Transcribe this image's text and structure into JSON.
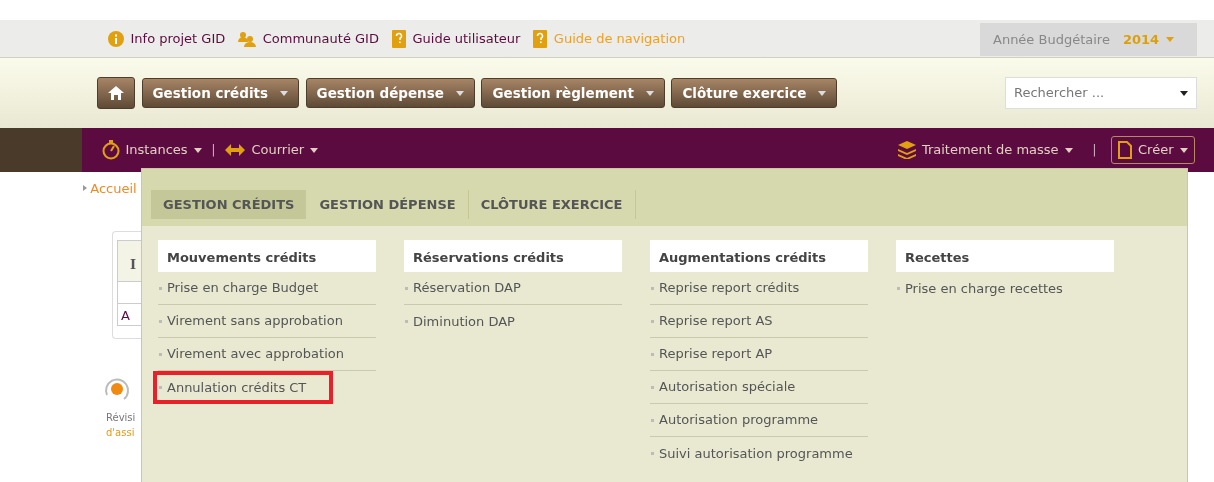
{
  "top_links": [
    {
      "label": "Info projet GID",
      "kind": "info",
      "selected": false
    },
    {
      "label": "Communauté GID",
      "kind": "community",
      "selected": false
    },
    {
      "label": "Guide utilisateur",
      "kind": "guide",
      "selected": false
    },
    {
      "label": "Guide de navigation",
      "kind": "guide",
      "selected": true
    }
  ],
  "year_selector": {
    "label": "Année Budgétaire",
    "value": "2014"
  },
  "main_nav": {
    "menus": [
      {
        "label": "Gestion crédits"
      },
      {
        "label": "Gestion dépense"
      },
      {
        "label": "Gestion règlement"
      },
      {
        "label": "Clôture exercice"
      }
    ]
  },
  "search": {
    "placeholder": "Rechercher ..."
  },
  "secondary_nav": {
    "left": [
      {
        "label": "Instances",
        "kind": "timer"
      },
      {
        "label": "Courrier",
        "kind": "exchange"
      }
    ],
    "right": [
      {
        "label": "Traitement de masse",
        "kind": "layers"
      }
    ],
    "separator": "|",
    "create_button": {
      "label": "Créer"
    }
  },
  "breadcrumb": "Accueil",
  "background": {
    "card_header": "I",
    "card_row": "A",
    "revision_line_1": "Révisi",
    "revision_line_2": "d'assi"
  },
  "mega_menu": {
    "tabs": [
      {
        "label": "GESTION CRÉDITS",
        "selected": true
      },
      {
        "label": "GESTION DÉPENSE",
        "selected": false
      },
      {
        "label": "CLÔTURE EXERCICE",
        "selected": false
      }
    ],
    "columns": [
      {
        "heading": "Mouvements crédits",
        "items": [
          {
            "label": "Prise en charge Budget",
            "highlighted": false
          },
          {
            "label": "Virement sans approbation",
            "highlighted": false
          },
          {
            "label": "Virement avec approbation",
            "highlighted": false
          },
          {
            "label": "Annulation crédits CT",
            "highlighted": true
          }
        ]
      },
      {
        "heading": "Réservations crédits",
        "items": [
          {
            "label": "Réservation DAP",
            "highlighted": false
          },
          {
            "label": "Diminution DAP",
            "highlighted": false
          }
        ]
      },
      {
        "heading": "Augmentations crédits",
        "items": [
          {
            "label": "Reprise report crédits",
            "highlighted": false
          },
          {
            "label": "Reprise report AS",
            "highlighted": false
          },
          {
            "label": "Reprise report AP",
            "highlighted": false
          },
          {
            "label": "Autorisation spéciale",
            "highlighted": false
          },
          {
            "label": "Autorisation programme",
            "highlighted": false
          },
          {
            "label": "Suivi autorisation programme",
            "highlighted": false
          }
        ]
      },
      {
        "heading": "Recettes",
        "items": [
          {
            "label": "Prise en charge recettes",
            "highlighted": false
          }
        ]
      }
    ]
  }
}
